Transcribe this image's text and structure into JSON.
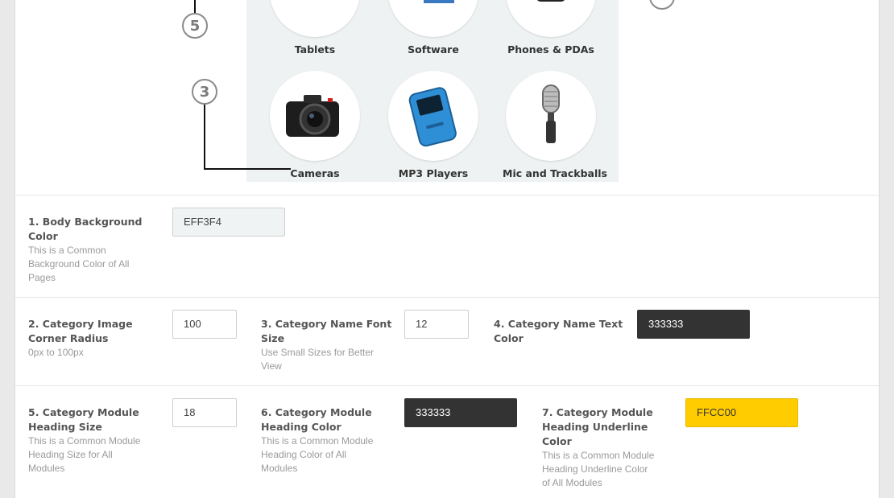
{
  "preview": {
    "categories": [
      {
        "label": "Tablets"
      },
      {
        "label": "Software"
      },
      {
        "label": "Phones & PDAs"
      },
      {
        "label": "Cameras"
      },
      {
        "label": "MP3 Players"
      },
      {
        "label": "Mic and Trackballs"
      }
    ],
    "callouts": {
      "five": "5",
      "three": "3"
    }
  },
  "settings": {
    "body_bg": {
      "title_line1": "1. Body Background",
      "title_line2": "Color",
      "desc_line1": "This is a Common",
      "desc_line2": "Background Color of All",
      "desc_line3": "Pages",
      "value": "EFF3F4",
      "color": "#EFF3F4"
    },
    "img_radius": {
      "title_line1": "2. Category Image",
      "title_line2": "Corner Radius",
      "desc_line1": "0px to 100px",
      "value": "100"
    },
    "name_font": {
      "title_line1": "3. Category Name Font",
      "title_line2": "Size",
      "desc_line1": "Use Small Sizes for Better",
      "desc_line2": "View",
      "value": "12"
    },
    "name_color": {
      "title_line1": "4. Category Name Text",
      "title_line2": "Color",
      "value": "333333",
      "color": "#333333"
    },
    "heading_size": {
      "title_line1": "5. Category Module",
      "title_line2": "Heading Size",
      "desc_line1": "This is a Common Module",
      "desc_line2": "Heading Size for All",
      "desc_line3": "Modules",
      "value": "18"
    },
    "heading_color": {
      "title_line1": "6. Category Module",
      "title_line2": "Heading Color",
      "desc_line1": "This is a Common Module",
      "desc_line2": "Heading Color of All",
      "desc_line3": "Modules",
      "value": "333333",
      "color": "#333333"
    },
    "underline_color": {
      "title_line1": "7. Category Module",
      "title_line2": "Heading Underline",
      "title_line3": "Color",
      "desc_line1": "This is a Common Module",
      "desc_line2": "Heading Underline Color",
      "desc_line3": "of All Modules",
      "value": "FFCC00",
      "color": "#FFCC00"
    }
  }
}
